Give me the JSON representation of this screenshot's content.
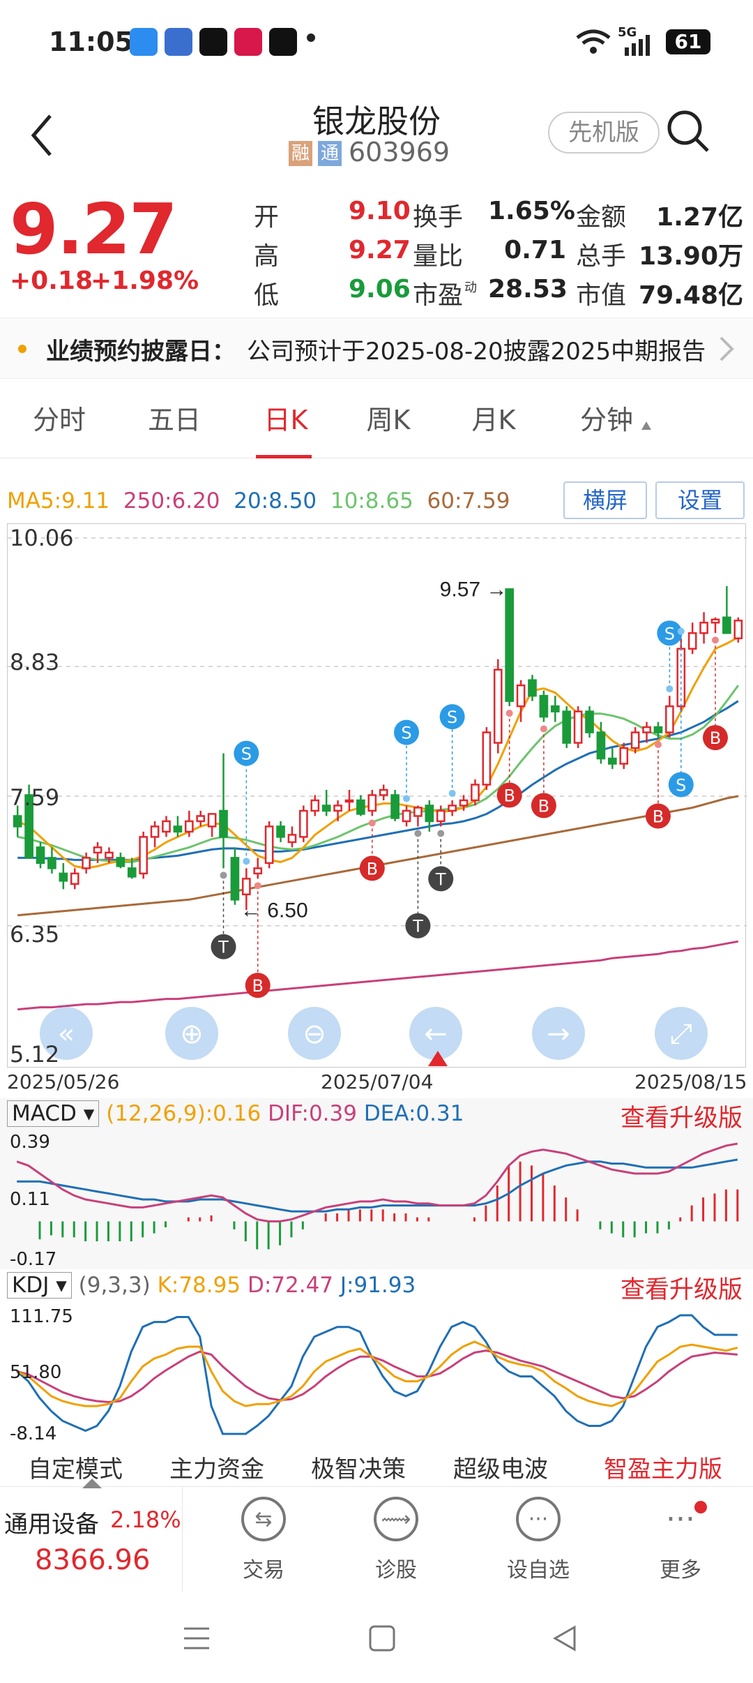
{
  "status": {
    "time": "11:05",
    "battery": "61",
    "signal": "5G"
  },
  "header": {
    "title": "银龙股份",
    "code": "603969",
    "badge1": "融",
    "badge2": "通",
    "mode_button": "先机版"
  },
  "quote": {
    "price": "9.27",
    "change": "+0.18",
    "change_pct": "+1.98%",
    "open_label": "开",
    "open": "9.10",
    "high_label": "高",
    "high": "9.27",
    "low_label": "低",
    "low": "9.06",
    "turnover_label": "换手",
    "turnover": "1.65%",
    "volratio_label": "量比",
    "volratio": "0.71",
    "pe_label": "市盈",
    "pe_sub": "动",
    "pe": "28.53",
    "amount_label": "金额",
    "amount": "1.27亿",
    "hands_label": "总手",
    "hands": "13.90万",
    "mktcap_label": "市值",
    "mktcap": "79.48亿"
  },
  "notice": {
    "label": "业绩预约披露日：",
    "text": "公司预计于2025-08-20披露2025中期报告"
  },
  "tabs": [
    "分时",
    "五日",
    "日K",
    "周K",
    "月K",
    "分钟"
  ],
  "active_tab": "日K",
  "ma": {
    "ma5": "MA5:9.11",
    "ma250": "250:6.20",
    "ma20": "20:8.50",
    "ma10": "10:8.65",
    "ma60": "60:7.59"
  },
  "chart_buttons": {
    "landscape": "横屏",
    "settings": "设置"
  },
  "chart_data": {
    "type": "candlestick",
    "y_ticks": [
      "10.06",
      "8.83",
      "7.59",
      "6.35",
      "5.12"
    ],
    "ylim": [
      5.12,
      10.06
    ],
    "x_ticks": [
      "2025/05/26",
      "2025/07/04",
      "2025/08/15"
    ],
    "annotations": {
      "high_label": "9.57",
      "low_label": "6.50"
    },
    "candles": [
      [
        7.4,
        7.5,
        7.2,
        7.3
      ],
      [
        7.6,
        7.7,
        7.0,
        7.0
      ],
      [
        7.1,
        7.15,
        6.9,
        6.95
      ],
      [
        7.0,
        7.1,
        6.85,
        6.9
      ],
      [
        6.85,
        6.95,
        6.7,
        6.78
      ],
      [
        6.75,
        6.9,
        6.7,
        6.85
      ],
      [
        6.9,
        7.05,
        6.85,
        7.0
      ],
      [
        7.05,
        7.15,
        6.95,
        7.1
      ],
      [
        7.0,
        7.1,
        6.95,
        7.05
      ],
      [
        7.0,
        7.05,
        6.9,
        6.92
      ],
      [
        6.9,
        7.0,
        6.8,
        6.82
      ],
      [
        6.85,
        7.25,
        6.8,
        7.2
      ],
      [
        7.2,
        7.35,
        7.1,
        7.3
      ],
      [
        7.25,
        7.4,
        7.2,
        7.35
      ],
      [
        7.3,
        7.4,
        7.2,
        7.25
      ],
      [
        7.25,
        7.45,
        7.2,
        7.35
      ],
      [
        7.35,
        7.45,
        7.3,
        7.4
      ],
      [
        7.3,
        7.4,
        7.2,
        7.42
      ],
      [
        7.45,
        8.0,
        6.9,
        7.2
      ],
      [
        7.0,
        7.1,
        6.55,
        6.6
      ],
      [
        6.65,
        6.9,
        6.5,
        6.8
      ],
      [
        6.85,
        7.0,
        6.8,
        6.9
      ],
      [
        6.95,
        7.35,
        6.9,
        7.3
      ],
      [
        7.3,
        7.35,
        7.15,
        7.2
      ],
      [
        7.15,
        7.3,
        7.1,
        7.22
      ],
      [
        7.2,
        7.5,
        7.15,
        7.45
      ],
      [
        7.45,
        7.6,
        7.4,
        7.55
      ],
      [
        7.5,
        7.65,
        7.4,
        7.45
      ],
      [
        7.45,
        7.55,
        7.35,
        7.5
      ],
      [
        7.55,
        7.65,
        7.45,
        7.55
      ],
      [
        7.55,
        7.6,
        7.4,
        7.42
      ],
      [
        7.45,
        7.65,
        7.4,
        7.6
      ],
      [
        7.6,
        7.7,
        7.55,
        7.65
      ],
      [
        7.6,
        7.65,
        7.35,
        7.38
      ],
      [
        7.35,
        7.5,
        7.3,
        7.45
      ],
      [
        7.4,
        7.5,
        7.3,
        7.48
      ],
      [
        7.5,
        7.55,
        7.25,
        7.35
      ],
      [
        7.35,
        7.5,
        7.3,
        7.45
      ],
      [
        7.45,
        7.55,
        7.4,
        7.5
      ],
      [
        7.5,
        7.6,
        7.45,
        7.55
      ],
      [
        7.55,
        7.75,
        7.5,
        7.7
      ],
      [
        7.7,
        8.25,
        7.65,
        8.2
      ],
      [
        8.1,
        8.9,
        8.0,
        8.8
      ],
      [
        9.57,
        9.57,
        8.45,
        8.5
      ],
      [
        8.45,
        8.7,
        8.3,
        8.65
      ],
      [
        8.7,
        8.75,
        8.5,
        8.55
      ],
      [
        8.55,
        8.6,
        8.3,
        8.35
      ],
      [
        8.45,
        8.55,
        8.3,
        8.4
      ],
      [
        8.4,
        8.45,
        8.05,
        8.1
      ],
      [
        8.1,
        8.45,
        8.05,
        8.4
      ],
      [
        8.4,
        8.45,
        8.15,
        8.2
      ],
      [
        8.2,
        8.3,
        7.9,
        7.95
      ],
      [
        7.95,
        8.05,
        7.85,
        7.9
      ],
      [
        7.9,
        8.1,
        7.85,
        8.05
      ],
      [
        8.05,
        8.25,
        8.0,
        8.2
      ],
      [
        8.2,
        8.3,
        8.1,
        8.25
      ],
      [
        8.25,
        8.3,
        8.15,
        8.2
      ],
      [
        8.2,
        8.55,
        8.15,
        8.45
      ],
      [
        8.45,
        9.1,
        8.4,
        9.0
      ],
      [
        9.0,
        9.25,
        8.95,
        9.15
      ],
      [
        9.15,
        9.35,
        9.05,
        9.25
      ],
      [
        9.25,
        9.3,
        9.15,
        9.28
      ],
      [
        9.3,
        9.6,
        9.2,
        9.15
      ],
      [
        9.1,
        9.3,
        9.06,
        9.27
      ]
    ],
    "ma5": [
      7.35,
      7.3,
      7.2,
      7.1,
      7.0,
      6.92,
      6.9,
      6.92,
      6.95,
      6.97,
      6.98,
      7.02,
      7.08,
      7.15,
      7.2,
      7.25,
      7.3,
      7.33,
      7.32,
      7.22,
      7.12,
      7.02,
      6.98,
      6.96,
      7.0,
      7.1,
      7.22,
      7.3,
      7.38,
      7.45,
      7.48,
      7.5,
      7.52,
      7.52,
      7.5,
      7.48,
      7.46,
      7.44,
      7.45,
      7.48,
      7.55,
      7.68,
      7.9,
      8.15,
      8.4,
      8.6,
      8.62,
      8.58,
      8.48,
      8.38,
      8.32,
      8.22,
      8.12,
      8.05,
      8.02,
      8.05,
      8.12,
      8.2,
      8.4,
      8.62,
      8.82,
      9.0,
      9.05,
      9.11
    ],
    "ma10": [
      7.2,
      7.18,
      7.15,
      7.12,
      7.08,
      7.04,
      7.0,
      6.98,
      6.97,
      6.96,
      6.96,
      6.98,
      7.01,
      7.04,
      7.07,
      7.1,
      7.14,
      7.18,
      7.2,
      7.19,
      7.17,
      7.14,
      7.11,
      7.09,
      7.08,
      7.09,
      7.12,
      7.16,
      7.2,
      7.25,
      7.3,
      7.34,
      7.38,
      7.41,
      7.43,
      7.44,
      7.45,
      7.46,
      7.47,
      7.48,
      7.51,
      7.57,
      7.66,
      7.78,
      7.92,
      8.05,
      8.17,
      8.26,
      8.32,
      8.36,
      8.38,
      8.38,
      8.36,
      8.33,
      8.28,
      8.22,
      8.17,
      8.14,
      8.14,
      8.18,
      8.25,
      8.36,
      8.5,
      8.65
    ],
    "ma20": [
      7.0,
      7.0,
      7.0,
      6.99,
      6.99,
      6.98,
      6.98,
      6.98,
      6.98,
      6.98,
      6.98,
      6.99,
      7.0,
      7.01,
      7.02,
      7.04,
      7.06,
      7.08,
      7.09,
      7.09,
      7.08,
      7.07,
      7.06,
      7.06,
      7.07,
      7.08,
      7.1,
      7.12,
      7.14,
      7.16,
      7.18,
      7.2,
      7.22,
      7.24,
      7.26,
      7.28,
      7.3,
      7.32,
      7.33,
      7.35,
      7.38,
      7.42,
      7.48,
      7.55,
      7.62,
      7.7,
      7.77,
      7.84,
      7.9,
      7.95,
      8.0,
      8.03,
      8.06,
      8.08,
      8.1,
      8.12,
      8.14,
      8.17,
      8.2,
      8.25,
      8.3,
      8.37,
      8.43,
      8.5
    ],
    "ma60": [
      6.45,
      6.46,
      6.47,
      6.48,
      6.49,
      6.5,
      6.51,
      6.52,
      6.53,
      6.54,
      6.55,
      6.56,
      6.57,
      6.58,
      6.59,
      6.6,
      6.62,
      6.64,
      6.66,
      6.68,
      6.7,
      6.72,
      6.74,
      6.76,
      6.78,
      6.8,
      6.82,
      6.84,
      6.86,
      6.88,
      6.9,
      6.92,
      6.94,
      6.96,
      6.98,
      7.0,
      7.02,
      7.04,
      7.06,
      7.08,
      7.1,
      7.12,
      7.14,
      7.16,
      7.18,
      7.2,
      7.22,
      7.24,
      7.26,
      7.28,
      7.3,
      7.32,
      7.34,
      7.36,
      7.38,
      7.4,
      7.42,
      7.44,
      7.46,
      7.48,
      7.51,
      7.54,
      7.57,
      7.59
    ],
    "ma250": [
      5.55,
      5.56,
      5.57,
      5.57,
      5.58,
      5.59,
      5.6,
      5.6,
      5.61,
      5.62,
      5.62,
      5.63,
      5.64,
      5.65,
      5.65,
      5.66,
      5.67,
      5.68,
      5.69,
      5.7,
      5.71,
      5.72,
      5.73,
      5.74,
      5.75,
      5.76,
      5.77,
      5.78,
      5.79,
      5.8,
      5.81,
      5.82,
      5.83,
      5.84,
      5.85,
      5.86,
      5.87,
      5.88,
      5.89,
      5.9,
      5.91,
      5.92,
      5.93,
      5.94,
      5.95,
      5.96,
      5.97,
      5.98,
      5.99,
      6.0,
      6.01,
      6.02,
      6.04,
      6.05,
      6.06,
      6.07,
      6.08,
      6.1,
      6.11,
      6.13,
      6.14,
      6.16,
      6.18,
      6.2
    ],
    "signals": [
      {
        "type": "T",
        "i": 18,
        "v": 6.15
      },
      {
        "type": "S",
        "i": 20,
        "v": 8.0
      },
      {
        "type": "B",
        "i": 21,
        "v": 5.78
      },
      {
        "type": "B",
        "i": 31,
        "v": 6.9
      },
      {
        "type": "S",
        "i": 34,
        "v": 8.2
      },
      {
        "type": "T",
        "i": 35,
        "v": 6.35
      },
      {
        "type": "T",
        "i": 37,
        "v": 6.8
      },
      {
        "type": "S",
        "i": 38,
        "v": 8.35
      },
      {
        "type": "B",
        "i": 43,
        "v": 7.6
      },
      {
        "type": "B",
        "i": 46,
        "v": 7.5
      },
      {
        "type": "B",
        "i": 56,
        "v": 7.4
      },
      {
        "type": "S",
        "i": 57,
        "v": 9.15
      },
      {
        "type": "S",
        "i": 58,
        "v": 7.7
      },
      {
        "type": "B",
        "i": 61,
        "v": 8.15
      }
    ],
    "macd": {
      "legend_name": "MACD",
      "params": "(12,26,9):0.16",
      "dif": "DIF:0.39",
      "dea": "DEA:0.31",
      "y_ticks": [
        "0.39",
        "0.11",
        "-0.17"
      ],
      "ylim": [
        -0.17,
        0.39
      ],
      "dif_series": [
        0.3,
        0.28,
        0.24,
        0.2,
        0.16,
        0.13,
        0.11,
        0.1,
        0.09,
        0.08,
        0.07,
        0.07,
        0.08,
        0.09,
        0.1,
        0.11,
        0.12,
        0.13,
        0.12,
        0.08,
        0.04,
        0.01,
        0.0,
        0.0,
        0.01,
        0.03,
        0.05,
        0.07,
        0.08,
        0.09,
        0.1,
        0.1,
        0.11,
        0.1,
        0.1,
        0.09,
        0.09,
        0.08,
        0.08,
        0.08,
        0.09,
        0.13,
        0.2,
        0.28,
        0.33,
        0.35,
        0.36,
        0.35,
        0.34,
        0.32,
        0.3,
        0.28,
        0.26,
        0.25,
        0.24,
        0.24,
        0.24,
        0.25,
        0.28,
        0.31,
        0.34,
        0.36,
        0.38,
        0.39
      ],
      "dea_series": [
        0.2,
        0.2,
        0.2,
        0.19,
        0.18,
        0.17,
        0.16,
        0.15,
        0.14,
        0.13,
        0.12,
        0.11,
        0.11,
        0.1,
        0.1,
        0.1,
        0.11,
        0.11,
        0.11,
        0.1,
        0.09,
        0.08,
        0.07,
        0.06,
        0.05,
        0.05,
        0.05,
        0.05,
        0.06,
        0.06,
        0.07,
        0.07,
        0.08,
        0.08,
        0.08,
        0.08,
        0.08,
        0.08,
        0.08,
        0.08,
        0.08,
        0.09,
        0.11,
        0.14,
        0.18,
        0.21,
        0.24,
        0.26,
        0.28,
        0.29,
        0.3,
        0.3,
        0.29,
        0.29,
        0.28,
        0.27,
        0.27,
        0.27,
        0.27,
        0.27,
        0.28,
        0.29,
        0.3,
        0.31
      ],
      "hist": [
        0.0,
        0.0,
        -0.09,
        -0.07,
        -0.08,
        -0.08,
        -0.1,
        -0.1,
        -0.1,
        -0.1,
        -0.1,
        -0.08,
        -0.06,
        -0.03,
        0.0,
        0.02,
        0.02,
        0.03,
        0.0,
        -0.04,
        -0.1,
        -0.14,
        -0.14,
        -0.12,
        -0.08,
        -0.04,
        0.0,
        0.04,
        0.04,
        0.06,
        0.06,
        0.06,
        0.06,
        0.04,
        0.04,
        0.02,
        0.02,
        0.0,
        0.0,
        0.0,
        0.02,
        0.08,
        0.18,
        0.28,
        0.3,
        0.28,
        0.24,
        0.18,
        0.12,
        0.06,
        0.0,
        -0.04,
        -0.06,
        -0.08,
        -0.08,
        -0.06,
        -0.06,
        -0.04,
        0.02,
        0.08,
        0.12,
        0.14,
        0.16,
        0.16
      ]
    },
    "kdj": {
      "legend_name": "KDJ",
      "params": "(9,3,3)",
      "k_label": "K:78.95",
      "d_label": "D:72.47",
      "j_label": "J:91.93",
      "y_ticks": [
        "111.75",
        "51.80",
        "-8.14"
      ],
      "ylim": [
        -8.14,
        111.75
      ],
      "k": [
        55,
        50,
        40,
        30,
        25,
        22,
        20,
        20,
        22,
        28,
        45,
        60,
        68,
        72,
        78,
        80,
        80,
        55,
        35,
        25,
        20,
        22,
        22,
        25,
        30,
        40,
        55,
        65,
        70,
        75,
        78,
        70,
        60,
        50,
        45,
        45,
        50,
        60,
        72,
        80,
        85,
        80,
        70,
        65,
        62,
        60,
        55,
        45,
        38,
        30,
        25,
        22,
        20,
        25,
        35,
        50,
        65,
        72,
        80,
        82,
        80,
        78,
        76,
        79
      ],
      "d": [
        55,
        52,
        46,
        40,
        34,
        30,
        27,
        25,
        24,
        25,
        30,
        38,
        48,
        56,
        63,
        70,
        75,
        72,
        60,
        50,
        40,
        33,
        28,
        26,
        27,
        32,
        40,
        50,
        58,
        65,
        70,
        70,
        66,
        60,
        55,
        50,
        50,
        53,
        60,
        68,
        74,
        76,
        74,
        70,
        66,
        63,
        60,
        55,
        50,
        45,
        40,
        35,
        30,
        28,
        30,
        37,
        45,
        55,
        63,
        70,
        72,
        74,
        73,
        72
      ],
      "j": [
        55,
        45,
        28,
        15,
        5,
        0,
        -5,
        0,
        15,
        40,
        75,
        100,
        105,
        105,
        110,
        110,
        90,
        20,
        -10,
        -15,
        -15,
        0,
        10,
        25,
        40,
        70,
        90,
        95,
        100,
        100,
        95,
        70,
        50,
        35,
        30,
        35,
        55,
        80,
        100,
        105,
        100,
        85,
        65,
        55,
        50,
        50,
        40,
        30,
        15,
        5,
        0,
        0,
        5,
        20,
        50,
        80,
        100,
        105,
        112,
        112,
        100,
        92,
        92,
        91.93
      ]
    },
    "tools": [
      "«",
      "⊕",
      "⊖",
      "←",
      "→",
      "⤢"
    ]
  },
  "macd_upgrade": "查看升级版",
  "kdj_upgrade": "查看升级版",
  "zone_tabs": [
    "自定模式",
    "主力资金",
    "极智决策",
    "超级电波",
    "智盈主力版"
  ],
  "bottom": {
    "index_name": "通用设备",
    "index_pct": "2.18%",
    "index_value": "8366.96",
    "actions": [
      {
        "label": "交易",
        "icon": "⇆"
      },
      {
        "label": "诊股",
        "icon": "⟿"
      },
      {
        "label": "设自选",
        "icon": "···"
      },
      {
        "label": "更多",
        "icon": "···"
      }
    ]
  },
  "colors": {
    "up": "#e0282e",
    "down": "#1a9b3a",
    "ma5": "#f0a000",
    "ma10": "#6cc46c",
    "ma20": "#1f6fb5",
    "ma60": "#a86a3a",
    "ma250": "#c8407a"
  }
}
